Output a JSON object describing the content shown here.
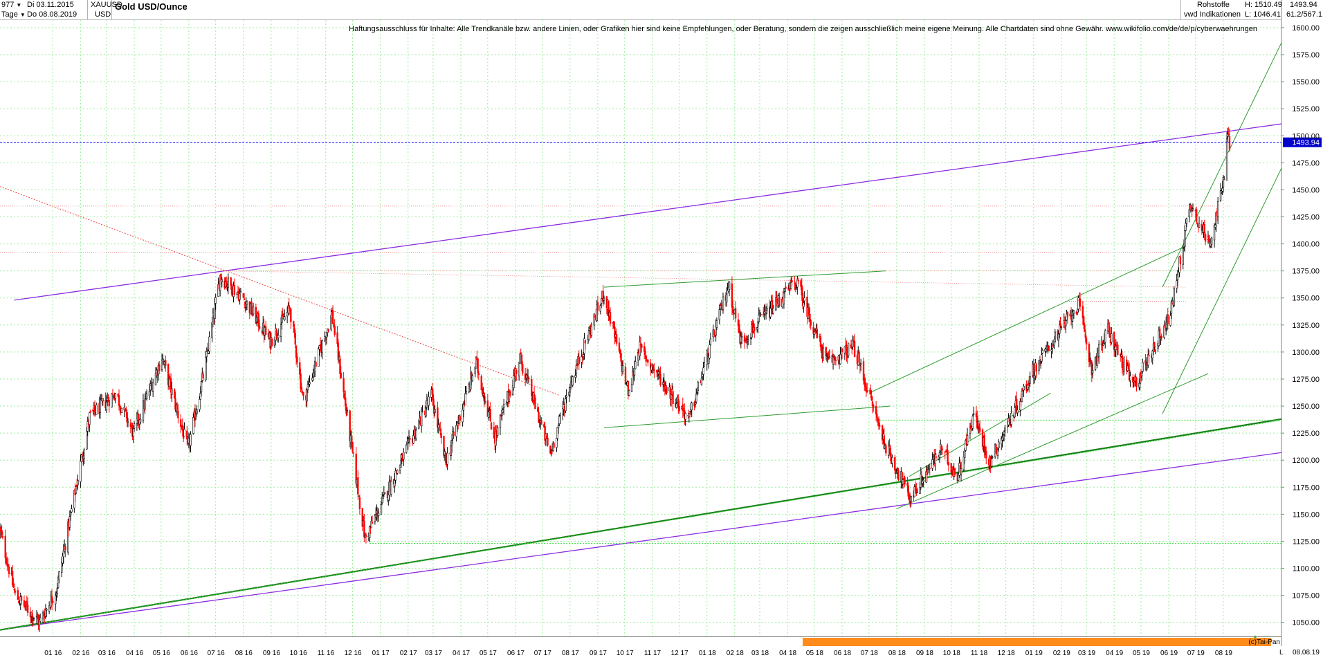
{
  "header": {
    "count": "977",
    "count_dropdown_icon": "caret-down-icon",
    "date_from": "Di 03.11.2015",
    "period": "Tage",
    "period_dropdown_icon": "caret-down-icon",
    "date_to": "Do 08.08.2019",
    "symbol": "XAUUSD",
    "currency": "USD",
    "title": "Gold USD/Ounce",
    "category": "Rohstoffe",
    "source": "vwd Indikationen",
    "high_label": "H: 1510.49",
    "low_label": "L: 1046.41",
    "last": "1493.94",
    "scale_info": "61.2/567.1"
  },
  "chart_data": {
    "type": "candlestick",
    "title": "Gold USD/Ounce",
    "disclaimer": "Haftungsausschluss für Inhalte: Alle Trendkanäle bzw. andere Linien, oder Grafiken hier sind keine Empfehlungen, oder Beratung, sondern die zeigen ausschließlich meine eigene Meinung. Alle Chartdaten sind ohne Gewähr.  www.wikifolio.com/de/de/p/cyberwaehrungen",
    "copyright": "(c)Tai-Pan",
    "y_range": [
      1037,
      1607
    ],
    "y_ticks": [
      1050,
      1075,
      1100,
      1125,
      1150,
      1175,
      1200,
      1225,
      1250,
      1275,
      1300,
      1325,
      1350,
      1375,
      1400,
      1425,
      1450,
      1475,
      1500,
      1525,
      1550,
      1575,
      1600
    ],
    "y_tick_labels": [
      "1050.00",
      "1075.00",
      "1100.00",
      "1125.00",
      "1150.00",
      "1175.00",
      "1200.00",
      "1225.00",
      "1250.00",
      "1275.00",
      "1300.00",
      "1325.00",
      "1350.00",
      "1375.00",
      "1400.00",
      "1425.00",
      "1450.00",
      "1475.00",
      "1500.00",
      "1525.00",
      "1550.00",
      "1575.00",
      "1600.00"
    ],
    "x_range": [
      "2015-11-03",
      "2019-10-05"
    ],
    "x_ticks": [
      {
        "label": "01 16",
        "date": "2016-01-01"
      },
      {
        "label": "02 16",
        "date": "2016-02-01"
      },
      {
        "label": "03 16",
        "date": "2016-03-01"
      },
      {
        "label": "04 16",
        "date": "2016-04-01"
      },
      {
        "label": "05 16",
        "date": "2016-05-01"
      },
      {
        "label": "06 16",
        "date": "2016-06-01"
      },
      {
        "label": "07 16",
        "date": "2016-07-01"
      },
      {
        "label": "08 16",
        "date": "2016-08-01"
      },
      {
        "label": "09 16",
        "date": "2016-09-01"
      },
      {
        "label": "10 16",
        "date": "2016-10-01"
      },
      {
        "label": "11 16",
        "date": "2016-11-01"
      },
      {
        "label": "12 16",
        "date": "2016-12-01"
      },
      {
        "label": "01 17",
        "date": "2017-01-01"
      },
      {
        "label": "02 17",
        "date": "2017-02-01"
      },
      {
        "label": "03 17",
        "date": "2017-03-01"
      },
      {
        "label": "04 17",
        "date": "2017-04-01"
      },
      {
        "label": "05 17",
        "date": "2017-05-01"
      },
      {
        "label": "06 17",
        "date": "2017-06-01"
      },
      {
        "label": "07 17",
        "date": "2017-07-01"
      },
      {
        "label": "08 17",
        "date": "2017-08-01"
      },
      {
        "label": "09 17",
        "date": "2017-09-01"
      },
      {
        "label": "10 17",
        "date": "2017-10-01"
      },
      {
        "label": "11 17",
        "date": "2017-11-01"
      },
      {
        "label": "12 17",
        "date": "2017-12-01"
      },
      {
        "label": "01 18",
        "date": "2018-01-01"
      },
      {
        "label": "02 18",
        "date": "2018-02-01"
      },
      {
        "label": "03 18",
        "date": "2018-03-01"
      },
      {
        "label": "04 18",
        "date": "2018-04-01"
      },
      {
        "label": "05 18",
        "date": "2018-05-01"
      },
      {
        "label": "06 18",
        "date": "2018-06-01"
      },
      {
        "label": "07 18",
        "date": "2018-07-01"
      },
      {
        "label": "08 18",
        "date": "2018-08-01"
      },
      {
        "label": "09 18",
        "date": "2018-09-01"
      },
      {
        "label": "10 18",
        "date": "2018-10-01"
      },
      {
        "label": "11 18",
        "date": "2018-11-01"
      },
      {
        "label": "12 18",
        "date": "2018-12-01"
      },
      {
        "label": "01 19",
        "date": "2019-01-01"
      },
      {
        "label": "02 19",
        "date": "2019-02-01"
      },
      {
        "label": "03 19",
        "date": "2019-03-01"
      },
      {
        "label": "04 19",
        "date": "2019-04-01"
      },
      {
        "label": "05 19",
        "date": "2019-05-01"
      },
      {
        "label": "06 19",
        "date": "2019-06-01"
      },
      {
        "label": "07 19",
        "date": "2019-07-01"
      },
      {
        "label": "08 19",
        "date": "2019-08-01"
      }
    ],
    "end_date_label": "08.08.19",
    "l_label": "L",
    "grid": true,
    "last_price": 1493.94,
    "last_price_label": "1493.94",
    "price_path": [
      [
        "2015-11-03",
        1135
      ],
      [
        "2015-11-20",
        1075
      ],
      [
        "2015-12-17",
        1050
      ],
      [
        "2016-01-05",
        1080
      ],
      [
        "2016-02-11",
        1240
      ],
      [
        "2016-03-11",
        1262
      ],
      [
        "2016-03-31",
        1225
      ],
      [
        "2016-05-02",
        1295
      ],
      [
        "2016-05-31",
        1210
      ],
      [
        "2016-06-20",
        1290
      ],
      [
        "2016-07-06",
        1370
      ],
      [
        "2016-08-01",
        1350
      ],
      [
        "2016-08-31",
        1310
      ],
      [
        "2016-09-22",
        1340
      ],
      [
        "2016-10-07",
        1255
      ],
      [
        "2016-11-08",
        1335
      ],
      [
        "2016-12-15",
        1127
      ],
      [
        "2017-01-25",
        1200
      ],
      [
        "2017-02-27",
        1260
      ],
      [
        "2017-03-15",
        1198
      ],
      [
        "2017-04-18",
        1290
      ],
      [
        "2017-05-09",
        1220
      ],
      [
        "2017-06-06",
        1295
      ],
      [
        "2017-07-10",
        1206
      ],
      [
        "2017-08-01",
        1270
      ],
      [
        "2017-09-08",
        1355
      ],
      [
        "2017-10-06",
        1260
      ],
      [
        "2017-10-16",
        1305
      ],
      [
        "2017-12-12",
        1238
      ],
      [
        "2018-01-25",
        1362
      ],
      [
        "2018-02-08",
        1310
      ],
      [
        "2018-04-11",
        1365
      ],
      [
        "2018-05-15",
        1290
      ],
      [
        "2018-06-14",
        1305
      ],
      [
        "2018-07-19",
        1215
      ],
      [
        "2018-08-16",
        1165
      ],
      [
        "2018-09-20",
        1210
      ],
      [
        "2018-10-08",
        1185
      ],
      [
        "2018-10-26",
        1243
      ],
      [
        "2018-11-13",
        1198
      ],
      [
        "2018-12-31",
        1282
      ],
      [
        "2019-02-20",
        1345
      ],
      [
        "2019-03-07",
        1285
      ],
      [
        "2019-03-25",
        1320
      ],
      [
        "2019-04-23",
        1268
      ],
      [
        "2019-06-03",
        1335
      ],
      [
        "2019-06-25",
        1438
      ],
      [
        "2019-07-16",
        1400
      ],
      [
        "2019-07-31",
        1450
      ],
      [
        "2019-08-07",
        1508
      ],
      [
        "2019-08-08",
        1494
      ]
    ],
    "lines": [
      {
        "name": "purple-upper-channel",
        "color": "#8b2be2",
        "width": 1.3,
        "dash": "",
        "from": [
          "2015-11-19",
          1348
        ],
        "to": [
          "2019-10-05",
          1511
        ]
      },
      {
        "name": "purple-lower-channel",
        "color": "#8b2be2",
        "width": 1.3,
        "dash": "",
        "from": [
          "2015-11-03",
          1043
        ],
        "to": [
          "2019-10-05",
          1207
        ]
      },
      {
        "name": "darkgreen-long-trend",
        "color": "#1a7f1a",
        "width": 2.2,
        "dash": "",
        "from": [
          "2015-11-03",
          1043
        ],
        "to": [
          "2019-10-05",
          1238
        ]
      },
      {
        "name": "green-dotted-support",
        "color": "#33d633",
        "width": 1,
        "dash": "2,2",
        "from": [
          "2015-11-03",
          1043
        ],
        "to": [
          "2019-10-05",
          1237
        ]
      },
      {
        "name": "red-dotted-downtrend",
        "color": "#ee4444",
        "width": 1,
        "dash": "2,2",
        "from": [
          "2015-11-03",
          1453
        ],
        "to": [
          "2017-07-20",
          1260
        ]
      },
      {
        "name": "red-level-1435",
        "color": "#e87a7a",
        "width": 0.8,
        "dash": "1,2",
        "from": [
          "2015-11-03",
          1435
        ],
        "to": [
          "2019-08-08",
          1435
        ]
      },
      {
        "name": "red-level-1392",
        "color": "#e87a7a",
        "width": 0.8,
        "dash": "1,2",
        "from": [
          "2015-11-03",
          1392
        ],
        "to": [
          "2019-08-08",
          1392
        ]
      },
      {
        "name": "red-level-1375",
        "color": "#e87a7a",
        "width": 0.8,
        "dash": "1,2",
        "from": [
          "2016-07-06",
          1375
        ],
        "to": [
          "2019-06-20",
          1375
        ]
      },
      {
        "name": "red-slope-1375-1360",
        "color": "#e87a7a",
        "width": 0.8,
        "dash": "1,2",
        "from": [
          "2016-07-10",
          1375
        ],
        "to": [
          "2019-06-20",
          1360
        ]
      },
      {
        "name": "red-level-1347",
        "color": "#e87a7a",
        "width": 0.8,
        "dash": "1,2",
        "from": [
          "2019-02-05",
          1347
        ],
        "to": [
          "2019-06-20",
          1347
        ]
      },
      {
        "name": "red-level-1245",
        "color": "#e87a7a",
        "width": 0.8,
        "dash": "1,2",
        "from": [
          "2018-10-25",
          1245
        ],
        "to": [
          "2018-12-20",
          1245
        ]
      },
      {
        "name": "green-level-1237",
        "color": "#33d633",
        "width": 1,
        "dash": "2,2",
        "from": [
          "2018-07-10",
          1237
        ],
        "to": [
          "2019-10-05",
          1237
        ]
      },
      {
        "name": "green-level-1123",
        "color": "#33d633",
        "width": 1,
        "dash": "2,2",
        "from": [
          "2016-12-20",
          1123
        ],
        "to": [
          "2019-10-05",
          1123
        ]
      },
      {
        "name": "green-resistance-2017-2018",
        "color": "#2e9a2e",
        "width": 1,
        "dash": "",
        "from": [
          "2017-09-08",
          1360
        ],
        "to": [
          "2018-07-20",
          1375
        ]
      },
      {
        "name": "green-support-2017-2018",
        "color": "#2e9a2e",
        "width": 1,
        "dash": "",
        "from": [
          "2017-09-08",
          1230
        ],
        "to": [
          "2018-07-25",
          1250
        ]
      },
      {
        "name": "green-channel-upper-2018",
        "color": "#2e9a2e",
        "width": 1,
        "dash": "",
        "from": [
          "2018-07-01",
          1262
        ],
        "to": [
          "2019-06-20",
          1398
        ]
      },
      {
        "name": "green-channel-lower-2018",
        "color": "#2e9a2e",
        "width": 1,
        "dash": "",
        "from": [
          "2018-08-01",
          1155
        ],
        "to": [
          "2019-07-15",
          1280
        ]
      },
      {
        "name": "green-channel-mid-2018",
        "color": "#2e9a2e",
        "width": 1,
        "dash": "",
        "from": [
          "2018-08-15",
          1185
        ],
        "to": [
          "2019-01-20",
          1262
        ]
      },
      {
        "name": "green-steep-upper",
        "color": "#2e9a2e",
        "width": 1,
        "dash": "",
        "from": [
          "2019-05-25",
          1360
        ],
        "to": [
          "2019-10-05",
          1586
        ]
      },
      {
        "name": "green-steep-lower",
        "color": "#2e9a2e",
        "width": 1,
        "dash": "",
        "from": [
          "2019-05-25",
          1243
        ],
        "to": [
          "2019-10-05",
          1470
        ]
      }
    ]
  },
  "colors": {
    "up_candle": "#000000",
    "down_candle": "#ff0000",
    "grid": "#99ee99",
    "last_price_line": "#0000ff",
    "last_price_box": "#0000cc",
    "bottom_band": "#ff8c1a"
  }
}
